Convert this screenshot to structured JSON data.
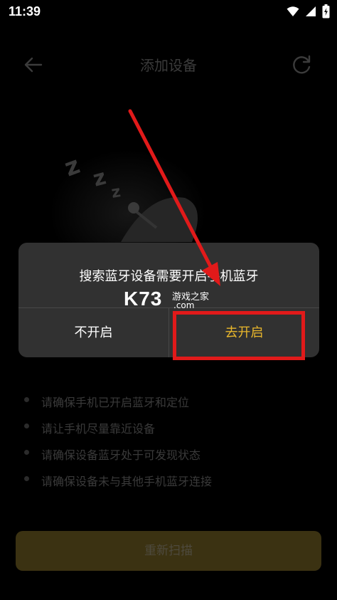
{
  "status_bar": {
    "time": "11:39"
  },
  "app_bar": {
    "title": "添加设备"
  },
  "tips": [
    "请确保手机已开启蓝牙和定位",
    "请让手机尽量靠近设备",
    "请确保设备蓝牙处于可发现状态",
    "请确保设备未与其他手机蓝牙连接"
  ],
  "rescan_label": "重新扫描",
  "dialog": {
    "message": "搜索蓝牙设备需要开启手机蓝牙",
    "cancel_label": "不开启",
    "confirm_label": "去开启"
  },
  "watermark": {
    "main": "K73",
    "cn": "游戏之家",
    "domain": ".com"
  },
  "colors": {
    "accent": "#e9b72c",
    "annotation": "#e11a1a",
    "dialog_bg": "#313131"
  }
}
